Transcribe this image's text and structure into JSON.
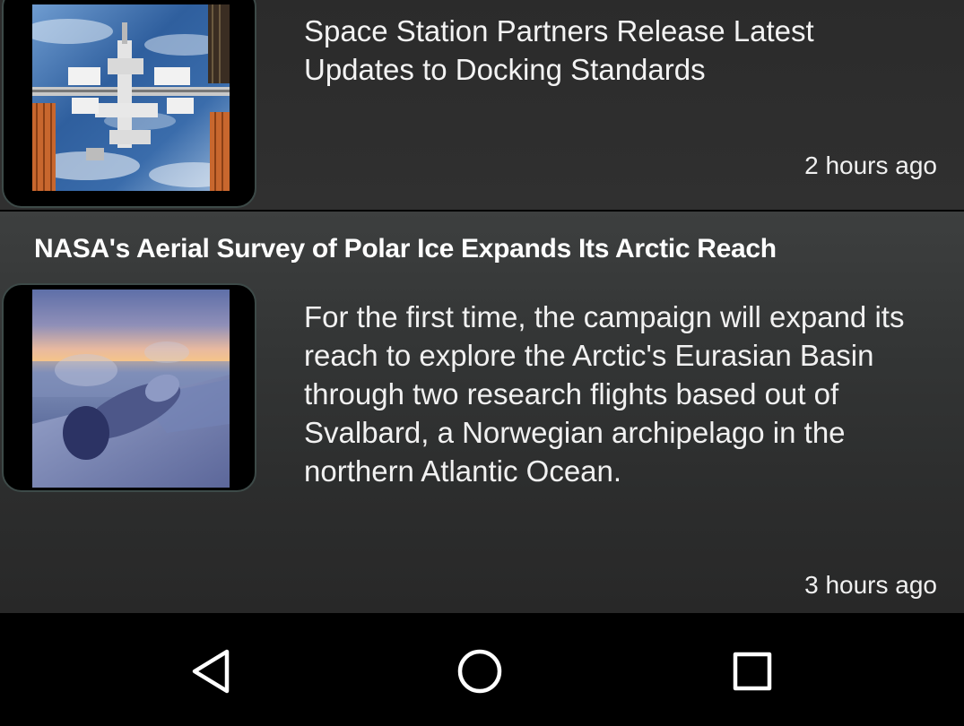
{
  "feed": {
    "items": [
      {
        "headline": "Space Station Partners Release Latest Updates to Docking Standards",
        "timestamp": "2 hours ago",
        "thumbnail": "space-station-photo"
      },
      {
        "title": "NASA's Aerial Survey of Polar Ice Expands Its Arctic Reach",
        "summary": "For the first time, the campaign will expand its reach to explore the Arctic's Eurasian Basin through two research flights based out of Svalbard, a Norwegian archipelago in the northern Atlantic Ocean.",
        "timestamp": "3 hours ago",
        "thumbnail": "aircraft-wing-sunset-photo"
      }
    ]
  },
  "navbar": {
    "buttons": [
      {
        "icon": "back-triangle-icon"
      },
      {
        "icon": "home-circle-icon"
      },
      {
        "icon": "recents-square-icon"
      }
    ]
  },
  "colors": {
    "card_background": "#2e2e2e",
    "text": "#f3f3f3",
    "navbar": "#000000",
    "thumb_border": "#3d4a48"
  }
}
